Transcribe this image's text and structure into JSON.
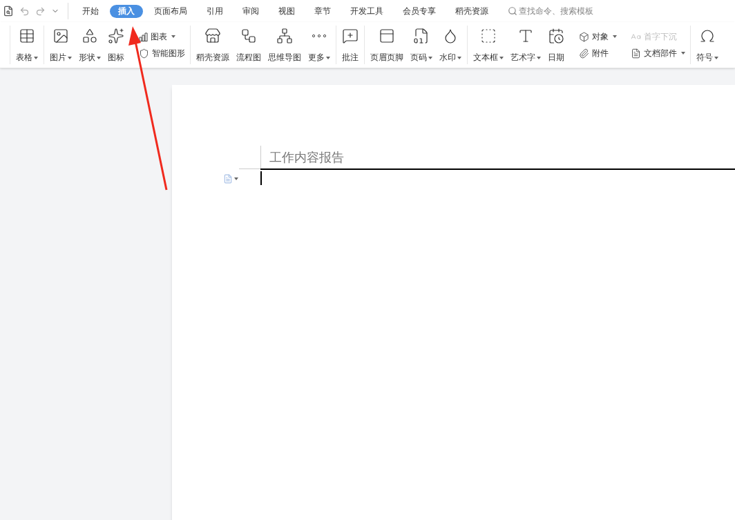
{
  "menu_tabs": [
    {
      "label": "开始",
      "selected": false
    },
    {
      "label": "插入",
      "selected": true
    },
    {
      "label": "页面布局",
      "selected": false
    },
    {
      "label": "引用",
      "selected": false
    },
    {
      "label": "审阅",
      "selected": false
    },
    {
      "label": "视图",
      "selected": false
    },
    {
      "label": "章节",
      "selected": false
    },
    {
      "label": "开发工具",
      "selected": false
    },
    {
      "label": "会员专享",
      "selected": false
    },
    {
      "label": "稻壳资源",
      "selected": false
    }
  ],
  "search": {
    "placeholder": "查找命令、搜索模板"
  },
  "ribbon_groups": [
    {
      "items": [
        {
          "kind": "large",
          "label": "表格",
          "dropdown": true
        }
      ]
    },
    {
      "items": [
        {
          "kind": "large",
          "label": "图片",
          "dropdown": true
        },
        {
          "kind": "large",
          "label": "形状",
          "dropdown": true
        },
        {
          "kind": "large",
          "label": "图标",
          "dropdown": false
        },
        {
          "kind": "pair",
          "items": [
            {
              "label": "图表",
              "dropdown": true,
              "disabled": false
            },
            {
              "label": "智能图形",
              "dropdown": false,
              "disabled": false
            }
          ]
        }
      ]
    },
    {
      "items": [
        {
          "kind": "large",
          "label": "稻壳资源",
          "dropdown": false
        },
        {
          "kind": "large",
          "label": "流程图",
          "dropdown": false
        },
        {
          "kind": "large",
          "label": "思维导图",
          "dropdown": false
        },
        {
          "kind": "large",
          "label": "更多",
          "dropdown": true
        }
      ]
    },
    {
      "items": [
        {
          "kind": "large",
          "label": "批注",
          "dropdown": false
        }
      ]
    },
    {
      "items": [
        {
          "kind": "large",
          "label": "页眉页脚",
          "dropdown": false
        },
        {
          "kind": "large",
          "label": "页码",
          "dropdown": true
        },
        {
          "kind": "large",
          "label": "水印",
          "dropdown": true
        }
      ]
    },
    {
      "items": [
        {
          "kind": "large",
          "label": "文本框",
          "dropdown": true
        },
        {
          "kind": "large",
          "label": "艺术字",
          "dropdown": true
        },
        {
          "kind": "large",
          "label": "日期",
          "dropdown": false
        },
        {
          "kind": "pair",
          "items": [
            {
              "label": "对象",
              "dropdown": true,
              "disabled": false
            },
            {
              "label": "附件",
              "dropdown": false,
              "disabled": false
            }
          ]
        },
        {
          "kind": "pair",
          "items": [
            {
              "label": "首字下沉",
              "dropdown": false,
              "disabled": true
            },
            {
              "label": "文档部件",
              "dropdown": true,
              "disabled": false
            }
          ]
        }
      ]
    },
    {
      "items": [
        {
          "kind": "large",
          "label": "符号",
          "dropdown": true
        }
      ]
    }
  ],
  "document": {
    "heading": "工作内容报告"
  }
}
